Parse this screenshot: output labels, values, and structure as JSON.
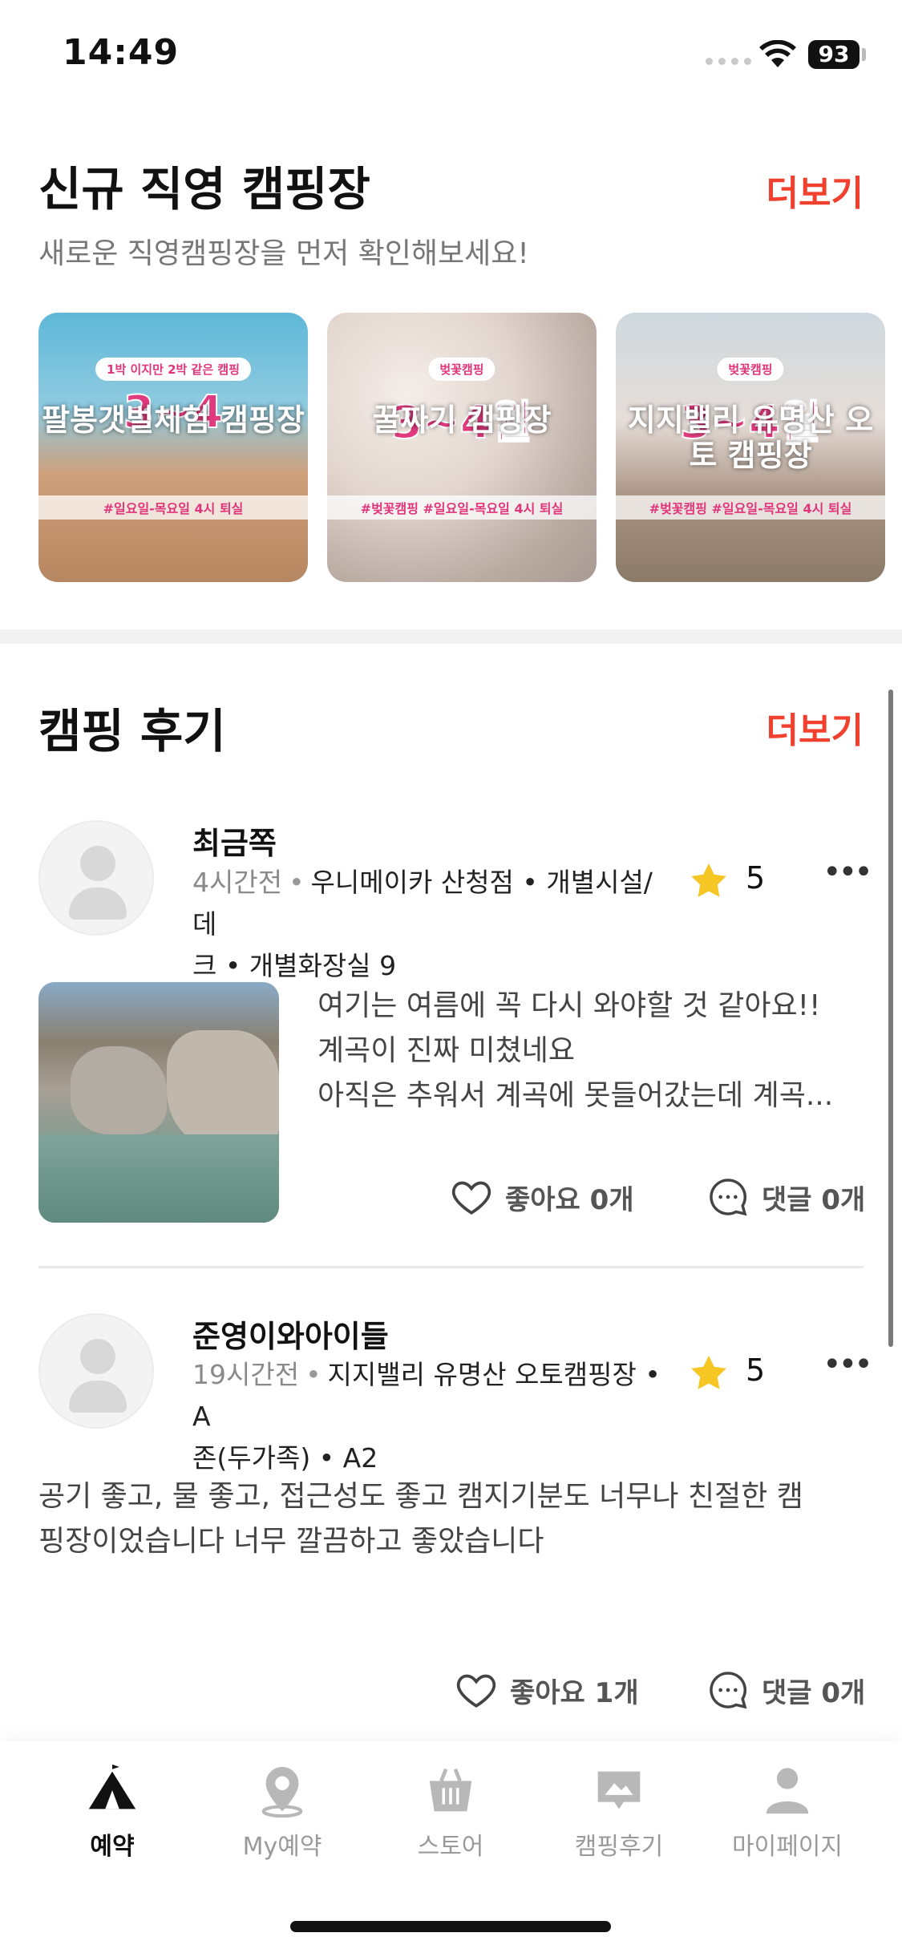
{
  "status": {
    "time": "14:49",
    "battery": "93"
  },
  "new_section": {
    "title": "신규 직영 캠핑장",
    "more": "더보기",
    "subtitle": "새로운 직영캠핑장을 먼저 확인해보세요!",
    "cards": [
      {
        "pill": "1박 이지만 2박 같은 캠핑",
        "big": "3~4",
        "name": "팔봉갯벌체험 캠핑장",
        "tag": "#일요일-목요일 4시 퇴실"
      },
      {
        "pill": "벚꽃캠핑",
        "big": "3~4월",
        "name": "꿀짜기 캠핑장",
        "tag": "#벚꽃캠핑 #일요일-목요일 4시 퇴실"
      },
      {
        "pill": "벚꽃캠핑",
        "big": "3~4월",
        "name": "지지밸리 유명산 오토 캠핑장",
        "tag": "#벚꽃캠핑 #일요일-목요일 4시 퇴실"
      }
    ]
  },
  "reviews_section": {
    "title": "캠핑 후기",
    "more": "더보기",
    "reviews": [
      {
        "user": "최금쪽",
        "ago": "4시간전",
        "meta_line1": "우니메이카 산청점 • 개별시설/ 데",
        "meta_line2": "크 • 개별화장실 9",
        "rating": "5",
        "text_lines": [
          "여기는 여름에 꼭 다시 와야할 것 같아요!!",
          "계곡이 진짜 미쳤네요",
          "아직은 추워서 계곡에 못들어갔는데 계곡..."
        ],
        "likes": "좋아요 0개",
        "comments": "댓글 0개"
      },
      {
        "user": "준영이와아이들",
        "ago": "19시간전",
        "meta_line1": "지지밸리 유명산 오토캠핑장 • A",
        "meta_line2": "존(두가족) • A2",
        "rating": "5",
        "text_lines": [
          "공기 좋고, 물 좋고, 접근성도 좋고 캠지기분도 너무나 친절한 캠",
          "핑장이었습니다 너무 깔끔하고 좋았습니다"
        ],
        "likes": "좋아요 1개",
        "comments": "댓글 0개"
      }
    ]
  },
  "tabs": [
    {
      "label": "예약",
      "icon": "tent-icon",
      "active": true
    },
    {
      "label": "My예약",
      "icon": "location-pin-icon",
      "active": false
    },
    {
      "label": "스토어",
      "icon": "shopping-basket-icon",
      "active": false
    },
    {
      "label": "캠핑후기",
      "icon": "photo-review-icon",
      "active": false
    },
    {
      "label": "마이페이지",
      "icon": "person-icon",
      "active": false
    }
  ],
  "colors": {
    "accent": "#f2402f",
    "star": "#f6c624",
    "card_text": "#e23a7e"
  }
}
